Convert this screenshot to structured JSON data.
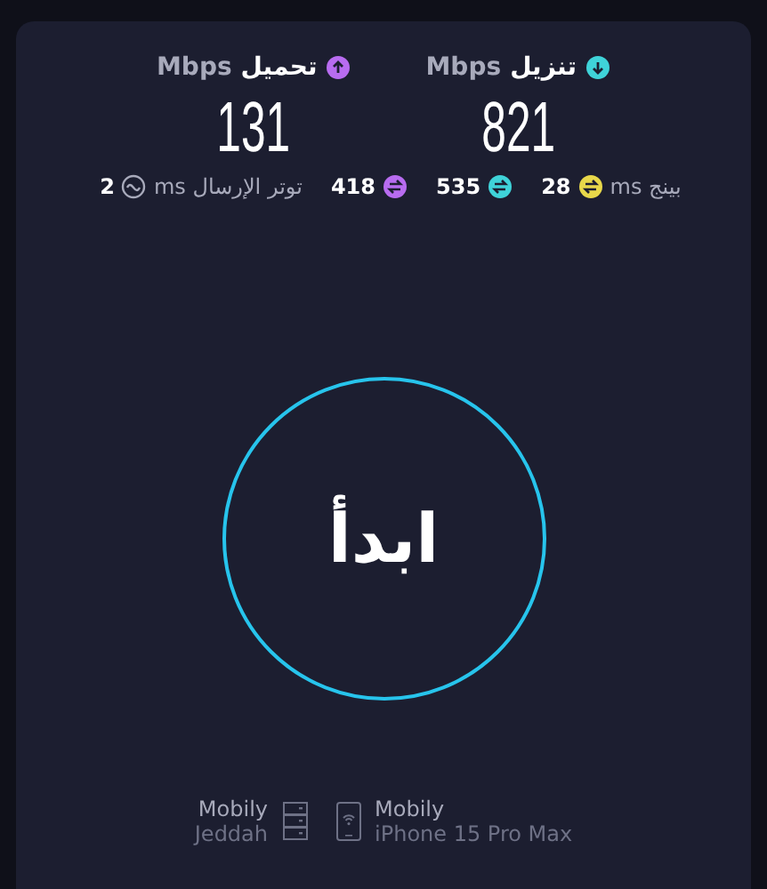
{
  "speeds": [
    {
      "kind": "download",
      "label": "تنزيل",
      "unit": "Mbps",
      "value": "821",
      "color": "#3fd3d9"
    },
    {
      "kind": "upload",
      "label": "تحميل",
      "unit": "Mbps",
      "value": "131",
      "color": "#b86cf0"
    }
  ],
  "metrics": [
    {
      "kind": "ping",
      "label": "بينج ms",
      "value": "28",
      "color": "#e8d84a"
    },
    {
      "kind": "latency",
      "value": "535",
      "color": "#3fd3d9"
    },
    {
      "kind": "latency",
      "value": "418",
      "color": "#b86cf0"
    },
    {
      "kind": "jitter",
      "label": "توتر الإرسال ms",
      "value": "2"
    }
  ],
  "start_button": {
    "label": "ابدأ"
  },
  "server": {
    "provider": "Mobily",
    "location": "Jeddah"
  },
  "device": {
    "provider": "Mobily",
    "name": "iPhone 15 Pro Max"
  }
}
